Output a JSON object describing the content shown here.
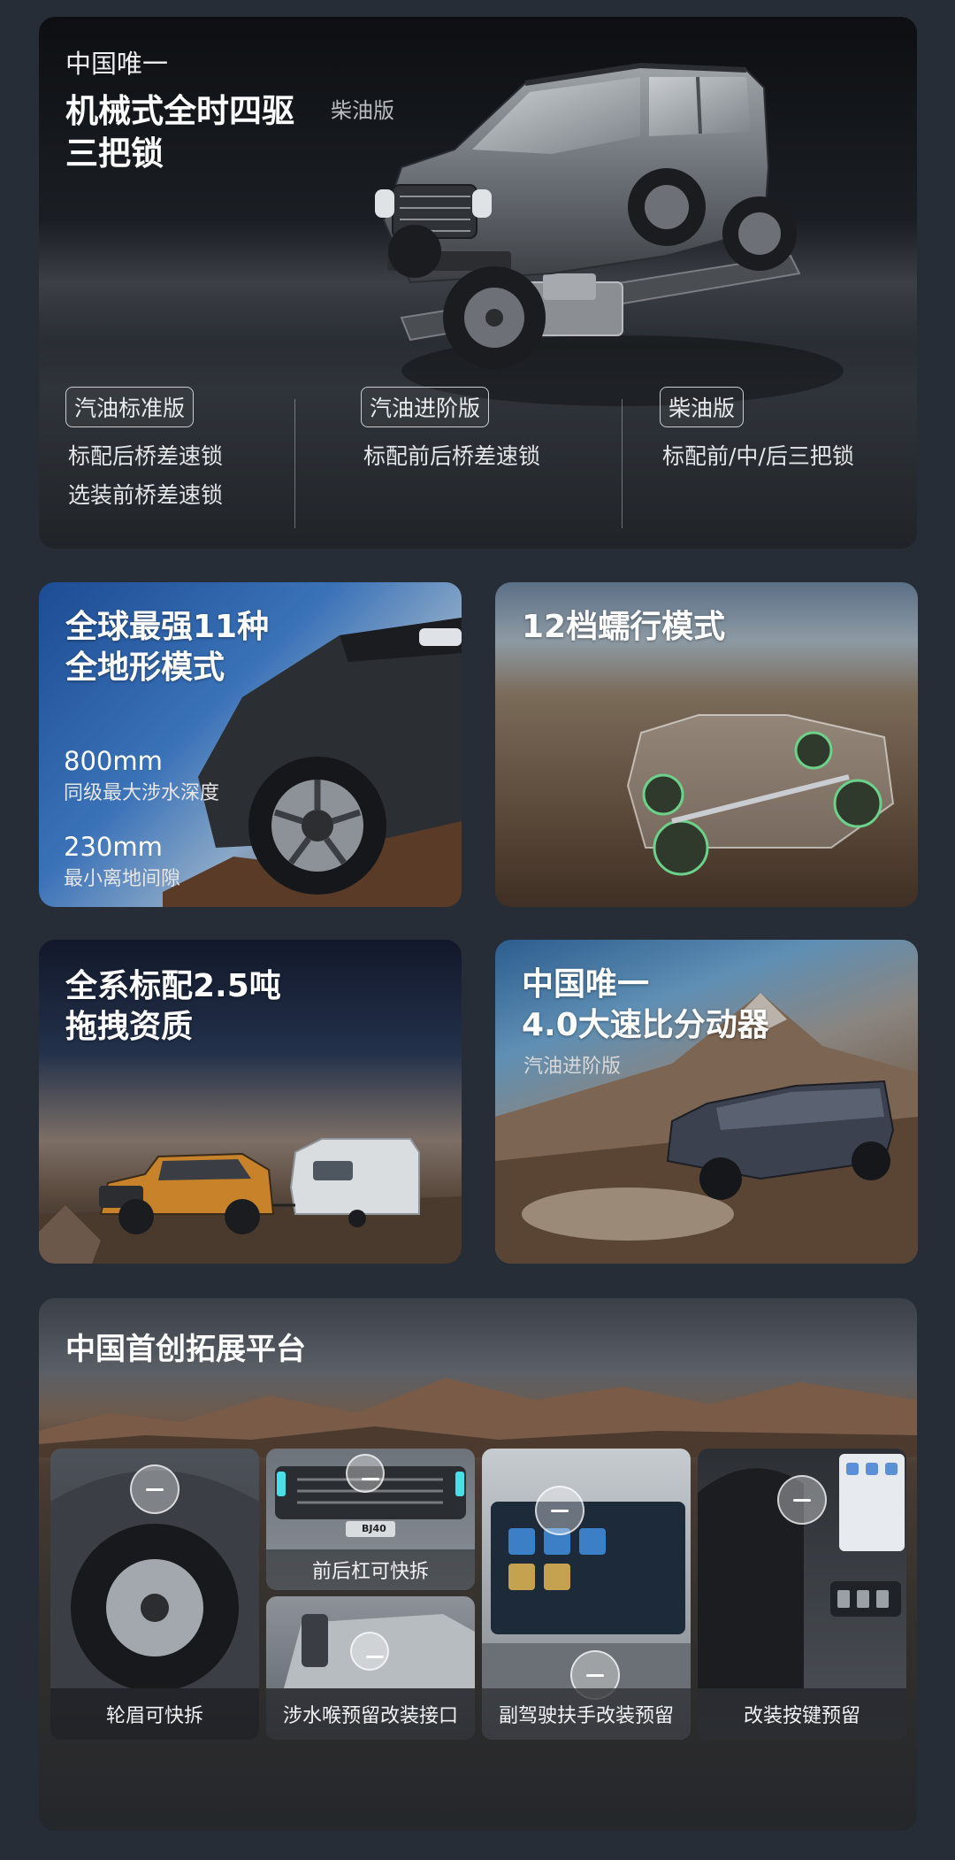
{
  "hero": {
    "kicker": "中国唯一",
    "title_line1": "机械式全时四驱",
    "title_tag": "柴油版",
    "title_line2": "三把锁",
    "columns": [
      {
        "chip": "汽油标准版",
        "lines": [
          "标配后桥差速锁",
          "选装前桥差速锁"
        ]
      },
      {
        "chip": "汽油进阶版",
        "lines": [
          "标配前后桥差速锁"
        ]
      },
      {
        "chip": "柴油版",
        "lines": [
          "标配前/中/后三把锁"
        ]
      }
    ]
  },
  "terrain": {
    "title_line1": "全球最强11种",
    "title_line2": "全地形模式",
    "stat1_value": "800mm",
    "stat1_label": "同级最大涉水深度",
    "stat2_value": "230mm",
    "stat2_label": "最小离地间隙"
  },
  "crawl": {
    "title": "12档蠕行模式"
  },
  "tow": {
    "title_line1": "全系标配2.5吨",
    "title_line2": "拖拽资质"
  },
  "transfer": {
    "title_line1": "中国唯一",
    "title_line2": "4.0大速比分动器",
    "sub": "汽油进阶版"
  },
  "platform": {
    "title": "中国首创拓展平台",
    "panels": [
      "轮眉可快拆",
      "前后杠可快拆",
      "涉水喉预留改装接口",
      "副驾驶扶手改装预留",
      "改装按键预留"
    ],
    "grille_badge": "BJ40"
  },
  "colors": {
    "background": "#262d36",
    "card_dark": "#1d2127"
  }
}
